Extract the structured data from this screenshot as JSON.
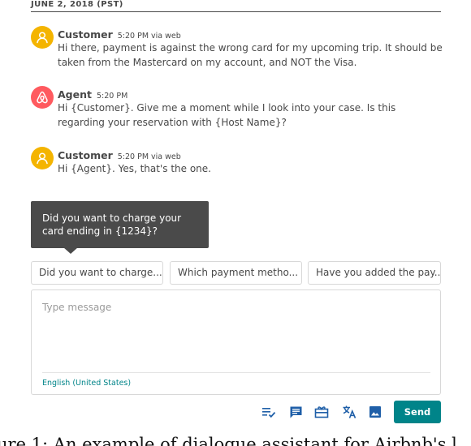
{
  "thread": {
    "date_header": "JUNE 2, 2018 (PST)",
    "messages": [
      {
        "sender": "Customer",
        "time": "5:20 PM via web",
        "text": "Hi there, payment is against the wrong card for my upcoming trip. It should be taken from the Mastercard on my account, and NOT the Visa.",
        "avatar_icon": "user-icon",
        "avatar_color": "#f4b400"
      },
      {
        "sender": "Agent",
        "time": "5:20 PM",
        "text": "Hi {Customer}. Give me a moment while I look into your case. Is this regarding your reservation with {Host Name}?",
        "avatar_icon": "airbnb-logo-icon",
        "avatar_color": "#ff5a5f"
      },
      {
        "sender": "Customer",
        "time": "5:20 PM via web",
        "text": "Hi {Agent}. Yes, that's the one.",
        "avatar_icon": "user-icon",
        "avatar_color": "#f4b400"
      }
    ]
  },
  "tooltip": {
    "text": "Did you want to charge your card ending in {1234}?"
  },
  "suggestions": [
    {
      "label": "Did you want to charge..."
    },
    {
      "label": "Which payment metho..."
    },
    {
      "label": "Have you added the pay..."
    }
  ],
  "composer": {
    "placeholder": "Type message",
    "language": "English (United States)"
  },
  "toolbar": {
    "icons": [
      "checklist-icon",
      "message-template-icon",
      "gift-card-icon",
      "translate-icon",
      "image-icon"
    ],
    "send_label": "Send",
    "accent_color": "#008489"
  },
  "caption": {
    "text": "ure 1: An example of dialogue assistant for Airbnb's l"
  }
}
